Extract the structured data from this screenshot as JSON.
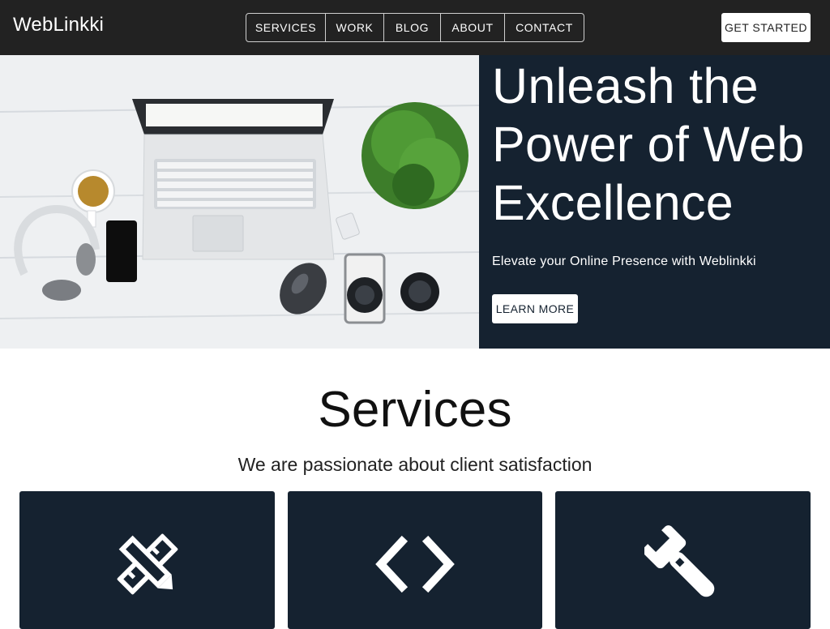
{
  "header": {
    "brand": "WebLinkki",
    "nav": [
      {
        "label": "SERVICES"
      },
      {
        "label": "WORK"
      },
      {
        "label": "BLOG"
      },
      {
        "label": "ABOUT"
      },
      {
        "label": "CONTACT"
      }
    ],
    "cta_label": "GET STARTED"
  },
  "hero": {
    "title": "Unleash the Power of Web Excellence",
    "subtitle": "Elevate your Online Presence with Weblinkki",
    "button_label": "LEARN MORE"
  },
  "services": {
    "title": "Services",
    "subtitle": "We are passionate about client satisfaction",
    "cards": [
      {
        "icon": "design-tools-icon"
      },
      {
        "icon": "code-icon"
      },
      {
        "icon": "wrench-icon"
      }
    ]
  },
  "colors": {
    "header_bg": "#222222",
    "hero_bg": "#152230",
    "card_bg": "#152230",
    "button_bg": "#ffffff"
  }
}
